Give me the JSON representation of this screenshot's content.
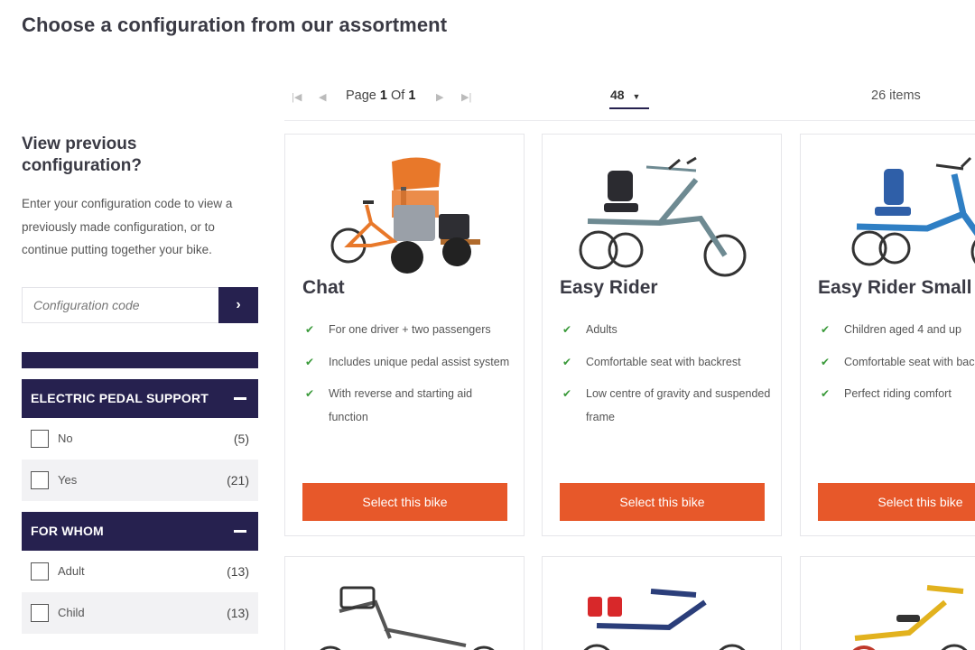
{
  "page": {
    "title": "Choose a configuration from our assortment"
  },
  "sidebar": {
    "heading": "View previous configuration?",
    "description": "Enter your configuration code to view a previously made configuration, or to continue putting together your bike.",
    "code_placeholder": "Configuration code",
    "code_button_icon": "chevron-right-icon",
    "filters": [
      {
        "title": "ELECTRIC PEDAL SUPPORT",
        "options": [
          {
            "label": "No",
            "count": "(5)"
          },
          {
            "label": "Yes",
            "count": "(21)"
          }
        ]
      },
      {
        "title": "FOR WHOM",
        "options": [
          {
            "label": "Adult",
            "count": "(13)"
          },
          {
            "label": "Child",
            "count": "(13)"
          }
        ]
      }
    ]
  },
  "toolbar": {
    "page_label": "Page",
    "page_current": "1",
    "page_of": "Of",
    "page_total": "1",
    "per_page": "48",
    "items_count": "26 items"
  },
  "products": [
    {
      "name": "Chat",
      "features": [
        "For one driver + two passengers",
        "Includes unique pedal assist system",
        "With reverse and starting aid function"
      ],
      "button": "Select this bike"
    },
    {
      "name": "Easy Rider",
      "features": [
        "Adults",
        "Comfortable seat with backrest",
        "Low centre of gravity and suspended frame"
      ],
      "button": "Select this bike"
    },
    {
      "name": "Easy Rider Small",
      "features": [
        "Children aged 4 and up",
        "Comfortable seat with backrest",
        "Perfect riding comfort"
      ],
      "button": "Select this bike"
    }
  ],
  "colors": {
    "navy": "#26214f",
    "orange": "#e7582a",
    "check_green": "#3a9a3a"
  }
}
